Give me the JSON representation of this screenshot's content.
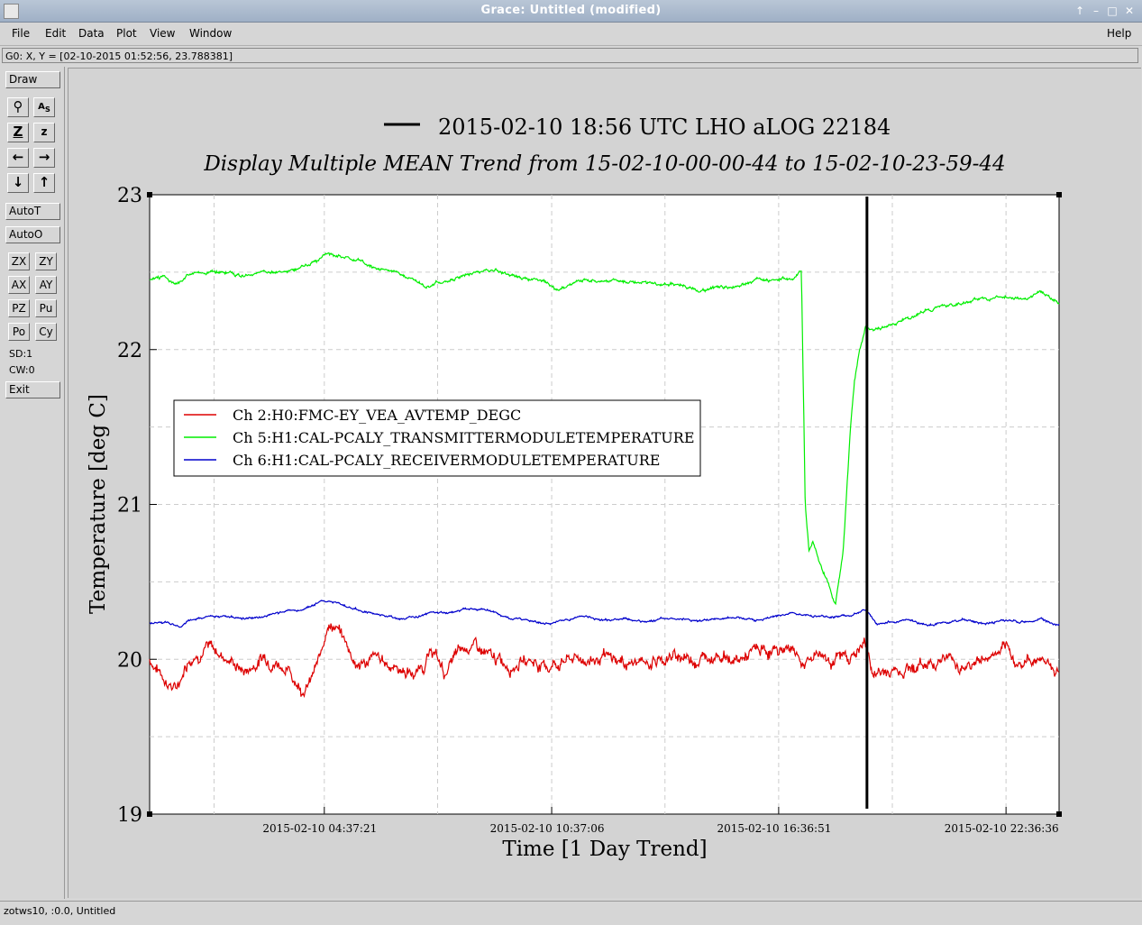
{
  "window": {
    "title": "Grace: Untitled (modified)"
  },
  "menu": {
    "file": "File",
    "edit": "Edit",
    "data": "Data",
    "plot": "Plot",
    "view": "View",
    "window": "Window",
    "help": "Help"
  },
  "locator": "G0: X, Y = [02-10-2015 01:52:56, 23.788381]",
  "toolbox": {
    "draw": "Draw",
    "autoT": "AutoT",
    "autoO": "AutoO",
    "zx": "ZX",
    "zy": "ZY",
    "ax": "AX",
    "ay": "AY",
    "pz": "PZ",
    "pu": "Pu",
    "po": "Po",
    "cy": "Cy",
    "sd": "SD:1",
    "cw": "CW:0",
    "exit": "Exit"
  },
  "status": "zotws10, :0.0, Untitled",
  "chart_data": {
    "type": "line",
    "title": "2015-02-10 18:56 UTC LHO aLOG 22184",
    "subtitle": "Display Multiple MEAN Trend from 15-02-10-00-00-44 to 15-02-10-23-59-44",
    "xlabel": "Time [1 Day Trend]",
    "ylabel": "Temperature [deg C]",
    "ylim": [
      19,
      23
    ],
    "xlim_hours": [
      0,
      24
    ],
    "y_ticks": [
      "19",
      "20",
      "21",
      "22",
      "23"
    ],
    "x_ticks": [
      {
        "label": "2015-02-10 04:37:21",
        "hour": 4.61
      },
      {
        "label": "2015-02-10 10:37:06",
        "hour": 10.61
      },
      {
        "label": "2015-02-10 16:36:51",
        "hour": 16.6
      },
      {
        "label": "2015-02-10 22:36:36",
        "hour": 22.6
      }
    ],
    "marker_hour": 18.93,
    "legend_position": "upper-left",
    "series": [
      {
        "name": "Ch 2:H0:FMC-EY_VEA_AVTEMP_DEGC",
        "color": "#dd0000",
        "x": [
          0,
          0.5,
          0.7,
          1,
          1.5,
          2,
          2.5,
          2.8,
          3,
          3.5,
          4,
          4.2,
          4.5,
          4.7,
          5,
          5.3,
          5.5,
          5.8,
          6,
          6.5,
          7,
          7.5,
          7.8,
          8,
          8.5,
          9,
          9.5,
          10,
          10.5,
          11,
          11.5,
          12,
          12.5,
          13,
          13.5,
          14,
          14.5,
          15,
          15.5,
          16,
          16.5,
          17,
          17.3,
          17.6,
          18,
          18.5,
          18.9,
          19.1,
          19.5,
          20,
          20.5,
          21,
          21.5,
          22,
          22.5,
          23,
          23.5,
          24
        ],
        "values": [
          20.0,
          19.85,
          19.8,
          20.0,
          20.08,
          20.02,
          19.92,
          19.97,
          20.02,
          19.97,
          19.82,
          19.84,
          20.0,
          20.25,
          20.18,
          20.05,
          19.95,
          20.0,
          20.0,
          19.95,
          19.9,
          20.05,
          19.9,
          20.0,
          20.1,
          20.0,
          19.97,
          20.0,
          19.95,
          20.0,
          20.0,
          20.0,
          19.98,
          19.97,
          20.0,
          20.02,
          20.0,
          20.05,
          19.98,
          20.05,
          20.05,
          20.08,
          19.95,
          20.05,
          20.0,
          20.02,
          20.1,
          19.9,
          19.92,
          19.95,
          19.97,
          20.02,
          19.95,
          20.0,
          20.05,
          19.97,
          20.02,
          19.92
        ]
      },
      {
        "name": "Ch 5:H1:CAL-PCALY_TRANSMITTERMODULETEMPERATURE",
        "color": "#00ee00",
        "x": [
          0,
          0.4,
          0.7,
          1,
          1.5,
          2,
          2.5,
          3,
          3.5,
          4,
          4.5,
          4.7,
          5,
          5.5,
          6,
          6.5,
          7,
          7.3,
          7.6,
          8,
          8.5,
          9,
          9.5,
          10,
          10.5,
          10.8,
          11.1,
          11.5,
          12,
          12.5,
          13,
          13.5,
          14,
          14.5,
          15,
          15.5,
          16,
          16.5,
          17,
          17.1,
          17.2,
          17.3,
          17.4,
          17.5,
          17.7,
          17.9,
          18.1,
          18.3,
          18.5,
          18.6,
          18.7,
          18.8,
          18.9,
          19.1,
          19.5,
          20,
          20.5,
          21,
          21.5,
          22,
          22.5,
          23,
          23.5,
          24
        ],
        "values": [
          22.45,
          22.47,
          22.43,
          22.48,
          22.5,
          22.5,
          22.48,
          22.5,
          22.5,
          22.53,
          22.58,
          22.62,
          22.6,
          22.58,
          22.52,
          22.5,
          22.45,
          22.4,
          22.43,
          22.45,
          22.5,
          22.52,
          22.48,
          22.45,
          22.43,
          22.38,
          22.43,
          22.45,
          22.45,
          22.45,
          22.43,
          22.42,
          22.42,
          22.38,
          22.4,
          22.42,
          22.45,
          22.45,
          22.45,
          22.48,
          22.5,
          21.0,
          20.7,
          20.75,
          20.6,
          20.5,
          20.35,
          20.7,
          21.5,
          21.8,
          21.95,
          22.05,
          22.15,
          22.12,
          22.15,
          22.2,
          22.25,
          22.28,
          22.3,
          22.32,
          22.35,
          22.33,
          22.37,
          22.3
        ]
      },
      {
        "name": "Ch 6:H1:CAL-PCALY_RECEIVERMODULETEMPERATURE",
        "color": "#0000cc",
        "x": [
          0,
          0.5,
          0.8,
          1,
          1.5,
          2,
          2.5,
          3,
          3.5,
          4,
          4.3,
          4.6,
          5,
          5.5,
          6,
          6.5,
          7,
          7.5,
          8,
          8.5,
          9,
          9.5,
          10,
          10.5,
          11,
          11.5,
          12,
          12.5,
          13,
          13.5,
          14,
          14.5,
          15,
          15.5,
          16,
          16.5,
          17,
          17.5,
          18,
          18.5,
          18.9,
          19.2,
          19.5,
          20,
          20.5,
          21,
          21.5,
          22,
          22.5,
          23,
          23.5,
          24
        ],
        "values": [
          20.23,
          20.24,
          20.21,
          20.25,
          20.27,
          20.28,
          20.26,
          20.28,
          20.3,
          20.32,
          20.35,
          20.38,
          20.36,
          20.32,
          20.29,
          20.27,
          20.27,
          20.3,
          20.31,
          20.33,
          20.31,
          20.26,
          20.25,
          20.23,
          20.26,
          20.28,
          20.25,
          20.26,
          20.24,
          20.26,
          20.27,
          20.24,
          20.26,
          20.27,
          20.25,
          20.28,
          20.3,
          20.28,
          20.27,
          20.28,
          20.32,
          20.22,
          20.24,
          20.25,
          20.22,
          20.24,
          20.26,
          20.23,
          20.25,
          20.24,
          20.26,
          20.22
        ]
      }
    ]
  }
}
